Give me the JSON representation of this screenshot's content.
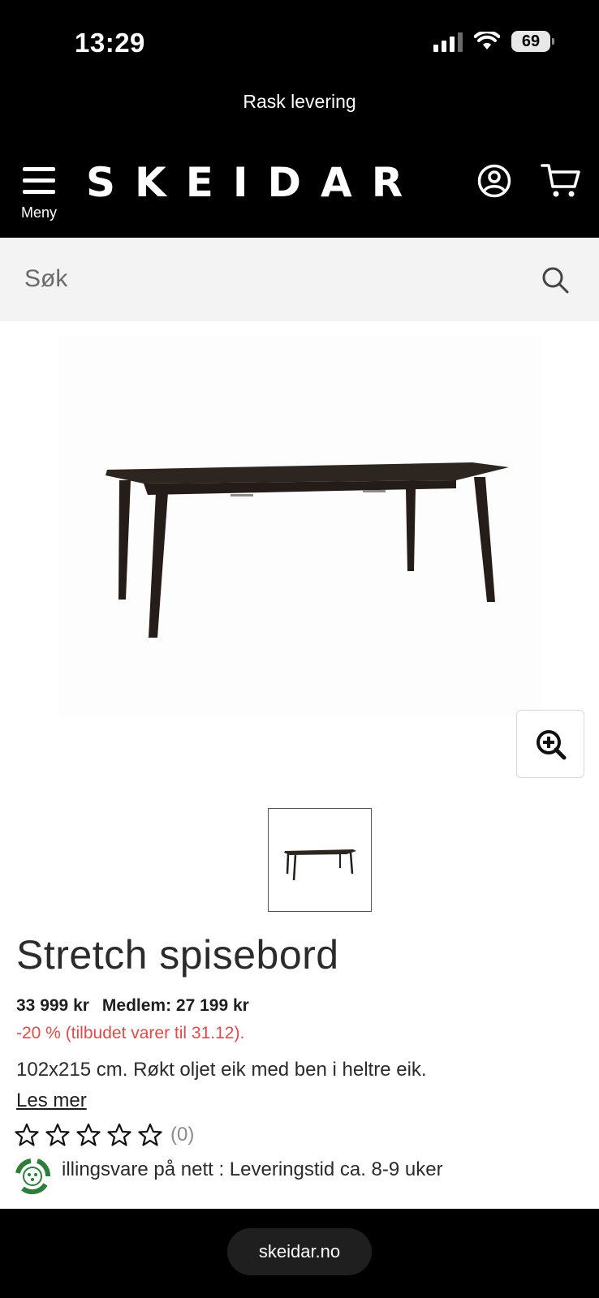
{
  "status_bar": {
    "time": "13:29",
    "battery": "69"
  },
  "announcement": {
    "text": "Rask levering"
  },
  "header": {
    "menu_label": "Meny",
    "logo": "SKEIDAR",
    "icons": [
      "user-icon",
      "cart-icon"
    ]
  },
  "search": {
    "placeholder": "Søk",
    "icon": "search-icon"
  },
  "product": {
    "title": "Stretch spisebord",
    "price": "33 999 kr",
    "member_price": "Medlem: 27 199 kr",
    "discount": "-20 % (tilbudet varer til 31.12).",
    "description": "102x215 cm. Røkt oljet eik med ben i heltre eik.",
    "read_more": "Les mer",
    "rating_stars": 0,
    "rating_max": 5,
    "rating_count": "(0)",
    "delivery": "illingsvare på nett : Leveringstid ca. 8-9 uker"
  },
  "browser": {
    "url": "skeidar.no"
  },
  "colors": {
    "discount": "#e04a4a",
    "header_bg": "#000000",
    "search_bg": "#f3f3f3"
  }
}
